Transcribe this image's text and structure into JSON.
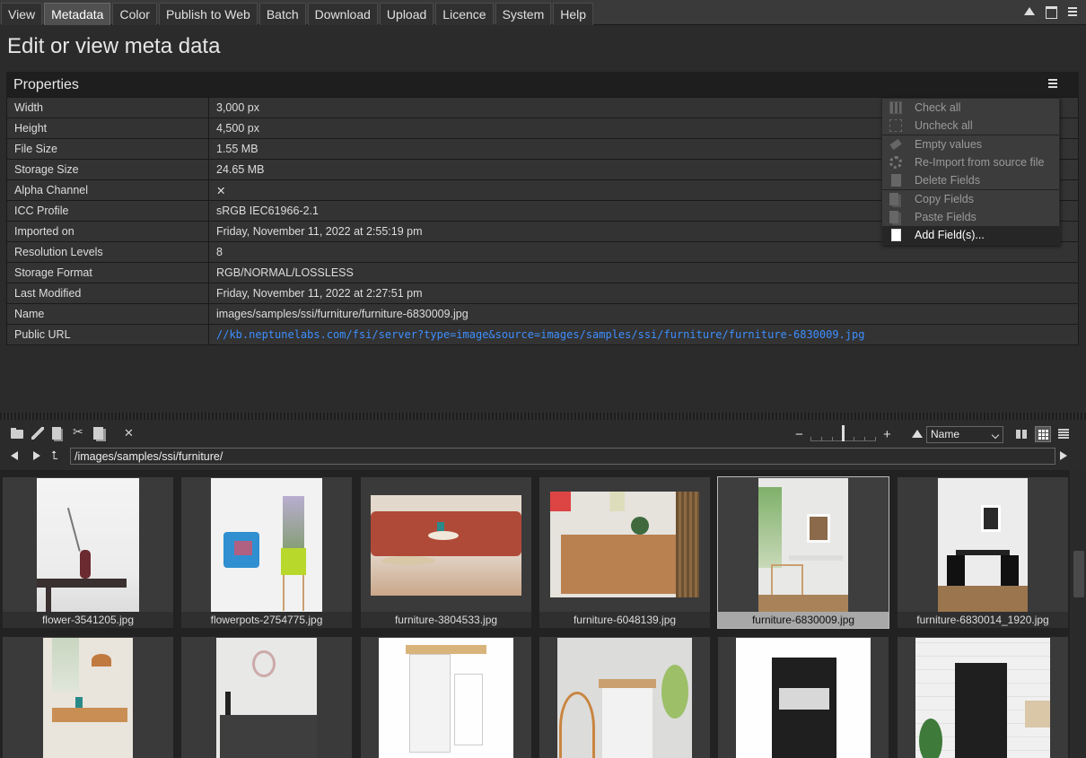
{
  "tabs": [
    {
      "label": "View"
    },
    {
      "label": "Metadata",
      "active": true
    },
    {
      "label": "Color"
    },
    {
      "label": "Publish to Web"
    },
    {
      "label": "Batch"
    },
    {
      "label": "Download"
    },
    {
      "label": "Upload"
    },
    {
      "label": "Licence"
    },
    {
      "label": "System"
    },
    {
      "label": "Help"
    }
  ],
  "page_title": "Edit or view meta data",
  "properties": {
    "title": "Properties",
    "rows": [
      {
        "key": "Width",
        "value": "3,000 px"
      },
      {
        "key": "Height",
        "value": "4,500 px"
      },
      {
        "key": "File Size",
        "value": "1.55 MB"
      },
      {
        "key": "Storage Size",
        "value": "24.65 MB"
      },
      {
        "key": "Alpha Channel",
        "value": "✕"
      },
      {
        "key": "ICC Profile",
        "value": "sRGB IEC61966-2.1"
      },
      {
        "key": "Imported on",
        "value": "Friday, November 11, 2022 at 2:55:19 pm"
      },
      {
        "key": "Resolution Levels",
        "value": "8"
      },
      {
        "key": "Storage Format",
        "value": "RGB/NORMAL/LOSSLESS"
      },
      {
        "key": "Last Modified",
        "value": "Friday, November 11, 2022 at 2:27:51 pm"
      },
      {
        "key": "Name",
        "value": "images/samples/ssi/furniture/furniture-6830009.jpg"
      },
      {
        "key": "Public URL",
        "value": "//kb.neptunelabs.com/fsi/server?type=image&source=images/samples/ssi/furniture/furniture-6830009.jpg"
      }
    ]
  },
  "context_menu": {
    "check_all": "Check all",
    "uncheck_all": "Uncheck all",
    "empty_values": "Empty values",
    "reimport": "Re-Import from source file",
    "delete_fields": "Delete Fields",
    "copy_fields": "Copy Fields",
    "paste_fields": "Paste Fields",
    "add_fields": "Add Field(s)..."
  },
  "browser": {
    "zoom_minus": "−",
    "zoom_plus": "+",
    "sort_by": "Name",
    "path": "/images/samples/ssi/furniture/",
    "files": [
      {
        "name": "flower-3541205.jpg"
      },
      {
        "name": "flowerpots-2754775.jpg"
      },
      {
        "name": "furniture-3804533.jpg"
      },
      {
        "name": "furniture-6048139.jpg"
      },
      {
        "name": "furniture-6830009.jpg",
        "selected": true
      },
      {
        "name": "furniture-6830014_1920.jpg"
      }
    ]
  }
}
